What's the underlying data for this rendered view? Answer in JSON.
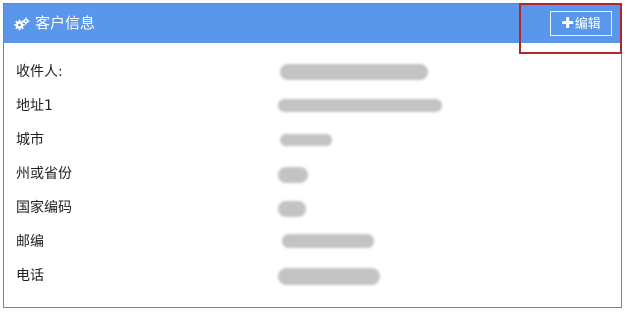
{
  "panel": {
    "title": "客户信息",
    "settings_icon": "gears-icon",
    "edit_button": {
      "icon": "plus-icon",
      "plus": "✚",
      "label": "编辑"
    },
    "colors": {
      "header": "#5a97ea",
      "border": "#4b8de3",
      "highlight": "#b2262c"
    }
  },
  "fields": [
    {
      "label": "收件人:"
    },
    {
      "label": "地址1"
    },
    {
      "label": "城市"
    },
    {
      "label": "州或省份"
    },
    {
      "label": "国家编码"
    },
    {
      "label": "邮编"
    },
    {
      "label": "电话"
    }
  ]
}
